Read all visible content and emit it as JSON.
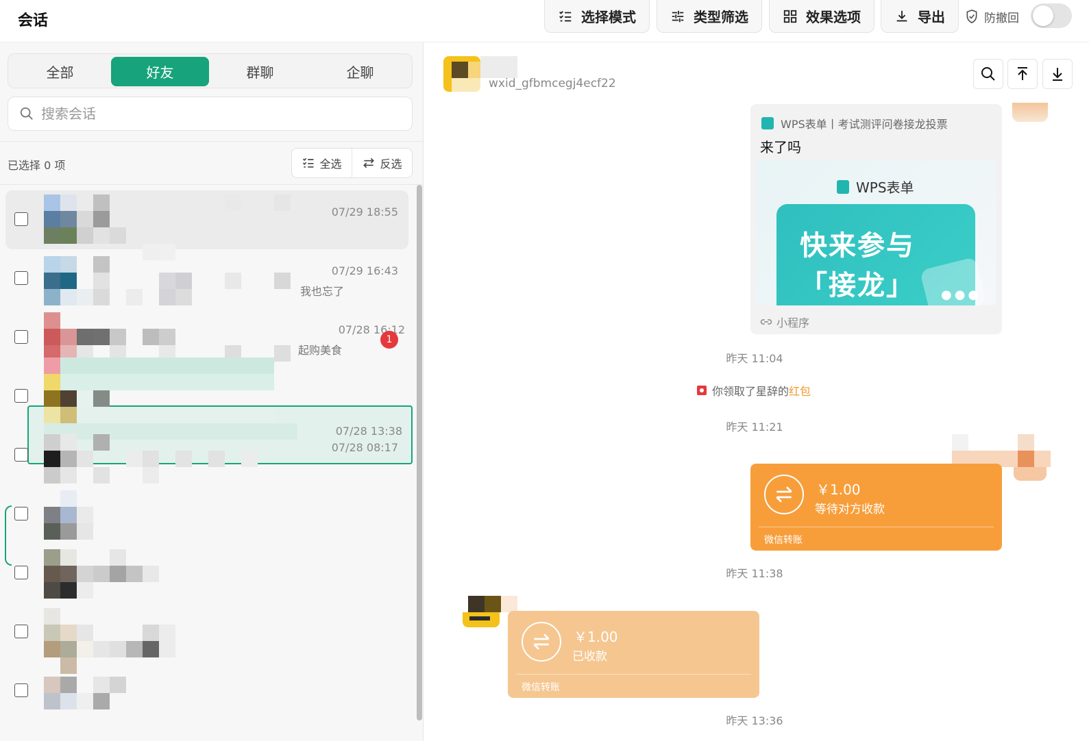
{
  "app": {
    "title": "会话"
  },
  "toolbar": {
    "select_mode": "选择模式",
    "type_filter": "类型筛选",
    "effect_options": "效果选项",
    "export": "导出",
    "anti_recall": "防撤回"
  },
  "tabs": [
    {
      "label": "全部",
      "active": false
    },
    {
      "label": "好友",
      "active": true
    },
    {
      "label": "群聊",
      "active": false
    },
    {
      "label": "企聊",
      "active": false
    }
  ],
  "search": {
    "placeholder": "搜索会话"
  },
  "selection": {
    "count_text": "已选择 0 项",
    "select_all": "全选",
    "invert": "反选"
  },
  "conversations": [
    {
      "time": "07/29 18:55",
      "preview": "",
      "badge": ""
    },
    {
      "time": "07/29 16:43",
      "preview": "我也忘了",
      "badge": ""
    },
    {
      "time": "07/28 16:12",
      "preview": "起购美食",
      "badge": "1"
    },
    {
      "time": "07/28 13:38",
      "preview": "",
      "badge": ""
    },
    {
      "time": "07/28 08:17",
      "preview": "",
      "badge": ""
    },
    {
      "time": "",
      "preview": "",
      "badge": ""
    },
    {
      "time": "",
      "preview": "",
      "badge": ""
    },
    {
      "time": "",
      "preview": "",
      "badge": ""
    },
    {
      "time": "",
      "preview": "",
      "badge": ""
    }
  ],
  "chat": {
    "wxid": "wxid_gfbmcegj4ecf22",
    "card": {
      "source": "WPS表单丨考试测评问卷接龙投票",
      "title": "来了吗",
      "image_brand": "WPS表单",
      "image_line1": "快来参与",
      "image_line2": "「接龙」",
      "footer": "小程序"
    },
    "ts1": "昨天 11:04",
    "system": {
      "prefix": "你领取了星辞的",
      "highlight": "红包"
    },
    "ts2": "昨天 11:21",
    "transfer_out": {
      "amount": "￥1.00",
      "status": "等待对方收款",
      "footer": "微信转账"
    },
    "ts3": "昨天 11:38",
    "transfer_in": {
      "amount": "￥1.00",
      "status": "已收款",
      "footer": "微信转账"
    },
    "ts4": "昨天 13:36"
  },
  "colors": {
    "accent": "#17a37b",
    "transfer_pending": "#f79e3b",
    "transfer_done": "#f5c690",
    "badge": "#e5393c"
  }
}
